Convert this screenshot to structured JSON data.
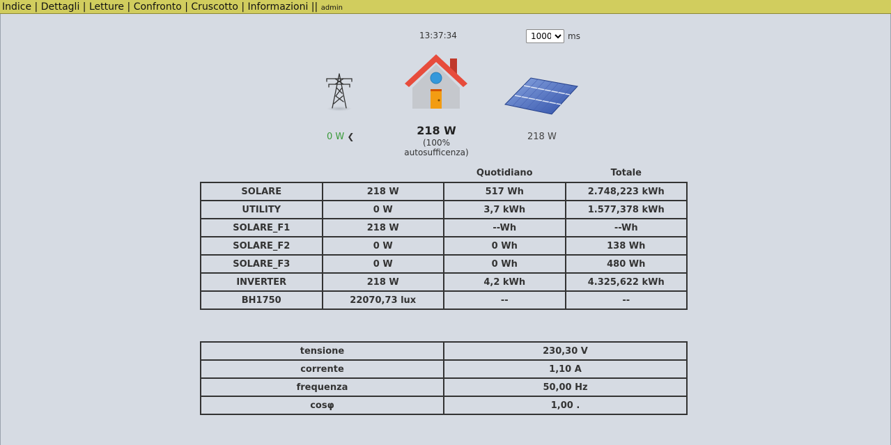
{
  "nav": {
    "items": [
      "Indice",
      "Dettagli",
      "Letture",
      "Confronto",
      "Cruscotto",
      "Informazioni"
    ],
    "separator": "|",
    "double_separator": "||",
    "user": "admin"
  },
  "clock": "13:37:34",
  "refresh": {
    "value": "1000",
    "options": [
      "1000"
    ],
    "unit": "ms"
  },
  "flow": {
    "grid_power": "0 W",
    "home_power": "218 W",
    "self_sufficiency": "(100% autosufficenza)",
    "solar_power": "218 W"
  },
  "energy_table": {
    "headers": [
      "",
      "",
      "Quotidiano",
      "Totale"
    ],
    "rows": [
      [
        "SOLARE",
        "218 W",
        "517 Wh",
        "2.748,223 kWh"
      ],
      [
        "UTILITY",
        "0 W",
        "3,7 kWh",
        "1.577,378 kWh"
      ],
      [
        "SOLARE_F1",
        "218 W",
        "--Wh",
        "--Wh"
      ],
      [
        "SOLARE_F2",
        "0 W",
        "0 Wh",
        "138 Wh"
      ],
      [
        "SOLARE_F3",
        "0 W",
        "0 Wh",
        "480 Wh"
      ],
      [
        "INVERTER",
        "218 W",
        "4,2 kWh",
        "4.325,622 kWh"
      ],
      [
        "BH1750",
        "22070,73 lux",
        "--",
        "--"
      ]
    ]
  },
  "electrical_table": {
    "rows": [
      [
        "tensione",
        "230,30 V"
      ],
      [
        "corrente",
        "1,10 A"
      ],
      [
        "frequenza",
        "50,00 Hz"
      ],
      [
        "cosφ",
        "1,00 ."
      ]
    ]
  },
  "colors": {
    "nav_bar": "#d1cd5e",
    "background": "#d6dbe3",
    "grid_power_text": "#3a9a3a"
  },
  "icons": [
    "power-pylon-icon",
    "house-icon",
    "solar-panel-icon",
    "arrow-left-icon"
  ]
}
